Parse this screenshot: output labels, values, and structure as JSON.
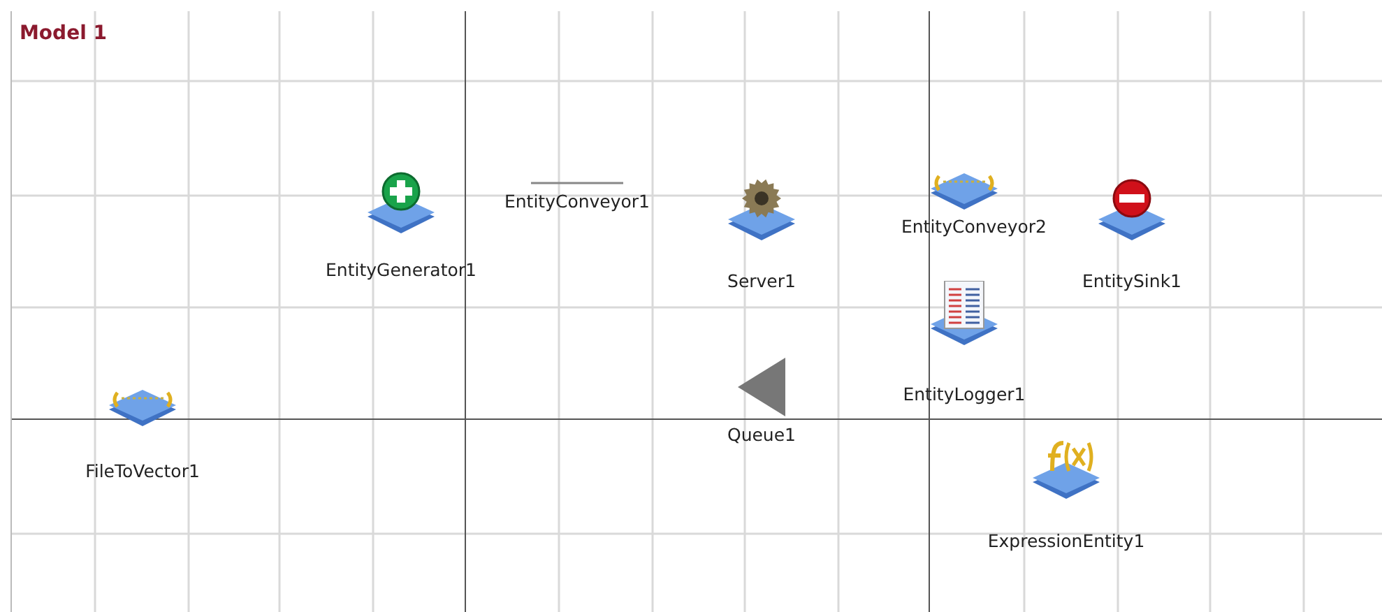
{
  "model_title": "Model 1",
  "blocks": [
    {
      "kind": "generator",
      "label": "EntityGenerator1"
    },
    {
      "kind": "conveyor",
      "label": "EntityConveyor1"
    },
    {
      "kind": "server",
      "label": "Server1"
    },
    {
      "kind": "conveyor_block",
      "label": "EntityConveyor2"
    },
    {
      "kind": "sink",
      "label": "EntitySink1"
    },
    {
      "kind": "file",
      "label": "FileToVector1"
    },
    {
      "kind": "logger",
      "label": "EntityLogger1"
    },
    {
      "kind": "queue",
      "label": "Queue1"
    },
    {
      "kind": "expression",
      "label": "ExpressionEntity1"
    }
  ]
}
